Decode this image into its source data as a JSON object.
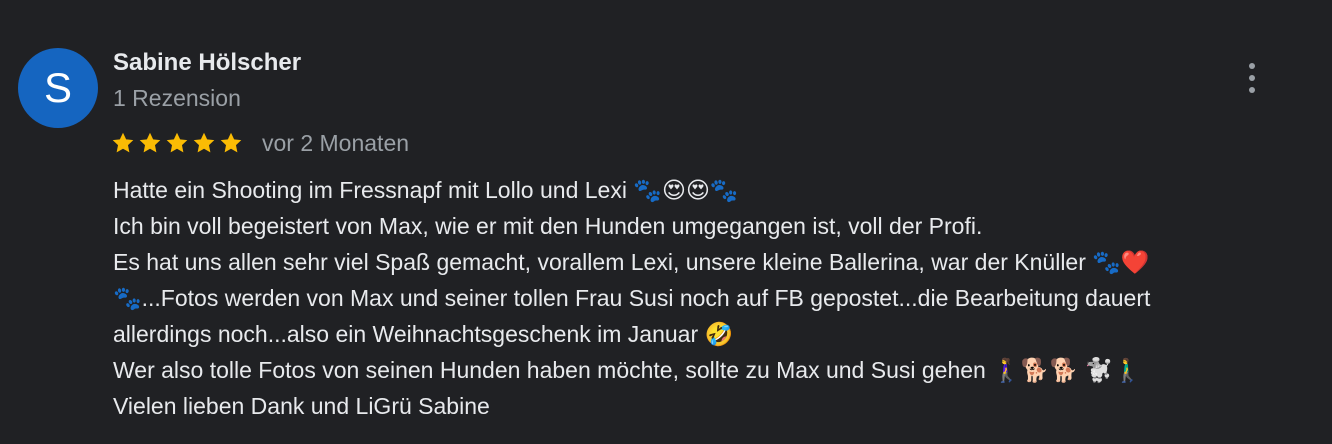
{
  "reviewer": {
    "initial": "S",
    "name": "Sabine Hölscher",
    "review_count": "1 Rezension",
    "avatar_color": "#1565c0"
  },
  "rating": {
    "stars": 5,
    "max_stars": 5,
    "star_color": "#fbbc04",
    "date": "vor 2 Monaten"
  },
  "menu": {
    "icon": "more-vert-icon"
  },
  "review": {
    "lines": [
      "Hatte ein Shooting im Fressnapf mit Lollo und Lexi 🐾😍😍🐾",
      "Ich bin voll begeistert von Max, wie er mit den Hunden umgegangen ist, voll der Profi.",
      "Es hat uns allen sehr viel Spaß gemacht, vorallem Lexi, unsere kleine Ballerina, war der Knüller 🐾❤️",
      "🐾...Fotos werden von Max und seiner tollen Frau Susi noch auf FB gepostet...die Bearbeitung dauert",
      "allerdings noch...also ein Weihnachtsgeschenk im Januar 🤣",
      "Wer also tolle Fotos von seinen Hunden haben möchte, sollte zu Max und Susi gehen 🚶‍♀️🐕🐕 🐩🚶‍♂️",
      "Vielen lieben Dank und LiGrü Sabine"
    ]
  }
}
